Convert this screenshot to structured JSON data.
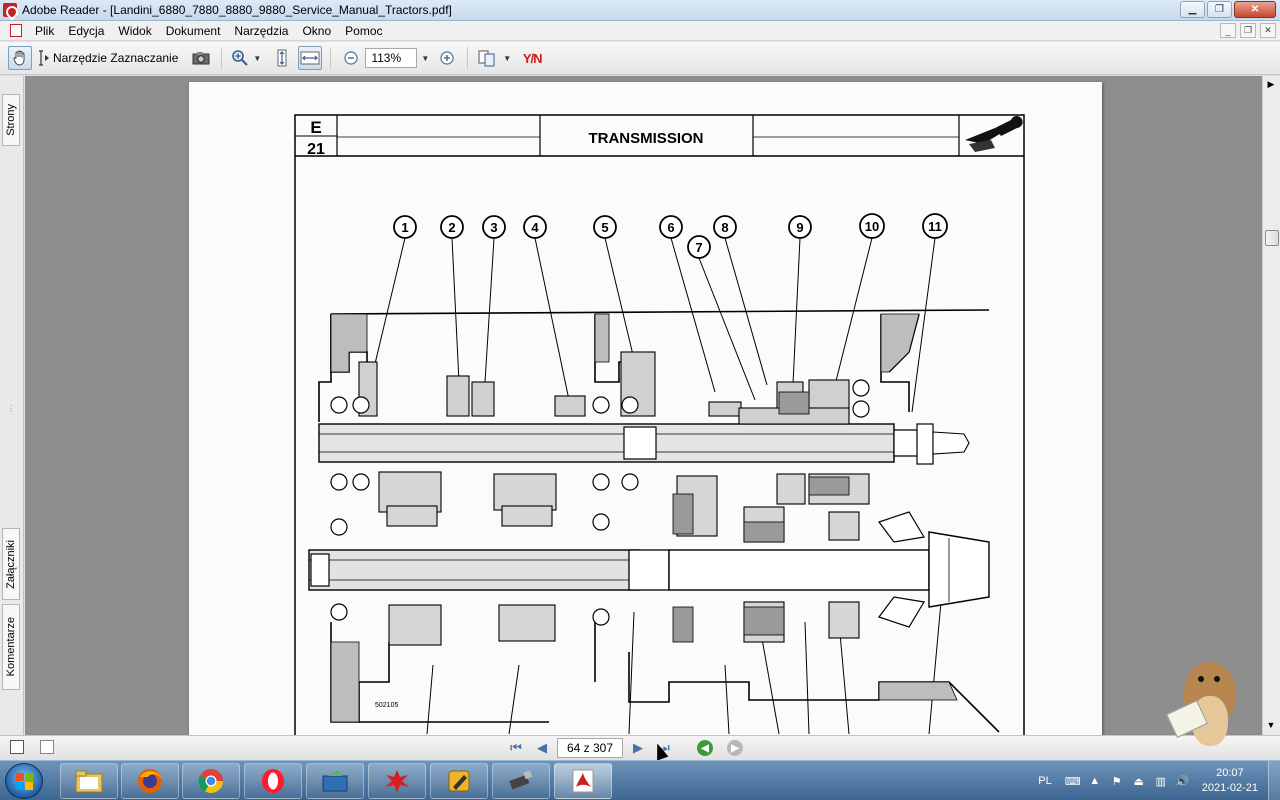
{
  "window": {
    "title": "Adobe Reader - [Landini_6880_7880_8880_9880_Service_Manual_Tractors.pdf]"
  },
  "menu": {
    "items": [
      "Plik",
      "Edycja",
      "Widok",
      "Dokument",
      "Narzędzia",
      "Okno",
      "Pomoc"
    ]
  },
  "toolbar": {
    "select_tool_label": "Narzędzie Zaznaczanie",
    "zoom_value": "113%"
  },
  "side_panel": {
    "tabs": [
      "Strony",
      "Załączniki",
      "Komentarze"
    ]
  },
  "document": {
    "header_section": "E",
    "header_page": "21",
    "header_title": "TRANSMISSION",
    "callouts": [
      "1",
      "2",
      "3",
      "4",
      "5",
      "6",
      "7",
      "8",
      "9",
      "10",
      "11"
    ],
    "drawing_ref": "502105"
  },
  "navigation": {
    "page_indicator": "64 z 307"
  },
  "taskbar": {
    "apps": [
      "file-explorer",
      "firefox",
      "chrome",
      "opera",
      "file-manager",
      "red-app",
      "pencil-tool",
      "usb-drive",
      "adobe-reader"
    ],
    "language": "PL",
    "time": "20:07",
    "date": "2021-02-21"
  }
}
